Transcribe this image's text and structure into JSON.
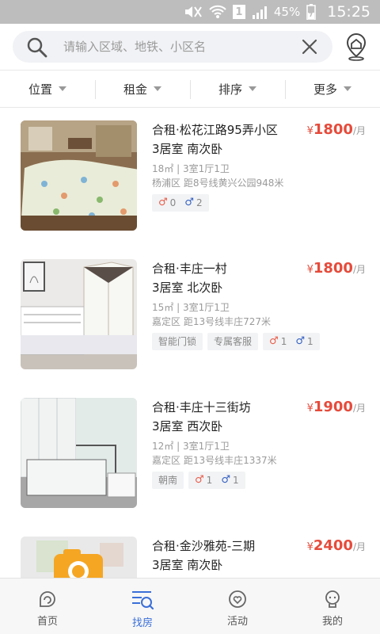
{
  "status_bar": {
    "battery": "45%",
    "time": "15:25",
    "sim": "1"
  },
  "search": {
    "placeholder": "请输入区域、地铁、小区名"
  },
  "filters": [
    "位置",
    "租金",
    "排序",
    "更多"
  ],
  "listings": [
    {
      "title": "合租·松花江路95弄小区",
      "rooms": "3居室 南次卧",
      "currency": "¥",
      "price": "1800",
      "unit": "/月",
      "area": "18㎡ | 3室1厅1卫",
      "location": "杨浦区 距8号线黄兴公园948米",
      "tags": [],
      "female_count": "0",
      "male_count": "2"
    },
    {
      "title": "合租·丰庄一村",
      "rooms": "3居室 北次卧",
      "currency": "¥",
      "price": "1800",
      "unit": "/月",
      "area": "15㎡ | 3室1厅1卫",
      "location": "嘉定区 距13号线丰庄727米",
      "tags": [
        "智能门锁",
        "专属客服"
      ],
      "female_count": "1",
      "male_count": "1"
    },
    {
      "title": "合租·丰庄十三街坊",
      "rooms": "3居室 西次卧",
      "currency": "¥",
      "price": "1900",
      "unit": "/月",
      "area": "12㎡ | 3室1厅1卫",
      "location": "嘉定区 距13号线丰庄1337米",
      "tags": [
        "朝南"
      ],
      "female_count": "1",
      "male_count": "1"
    },
    {
      "title": "合租·金沙雅苑-三期",
      "rooms": "3居室 南次卧",
      "currency": "¥",
      "price": "2400",
      "unit": "/月"
    }
  ],
  "gender_symbols": {
    "female": "♂",
    "male": "♂"
  },
  "tabs": [
    {
      "label": "首页",
      "icon": "home-icon",
      "active": false
    },
    {
      "label": "找房",
      "icon": "find-room-icon",
      "active": true
    },
    {
      "label": "活动",
      "icon": "activity-icon",
      "active": false
    },
    {
      "label": "我的",
      "icon": "profile-icon",
      "active": false
    }
  ],
  "colors": {
    "price": "#e64b3b",
    "active_tab": "#3a6fd8",
    "female": "#e85d4a",
    "male": "#3461c2"
  }
}
